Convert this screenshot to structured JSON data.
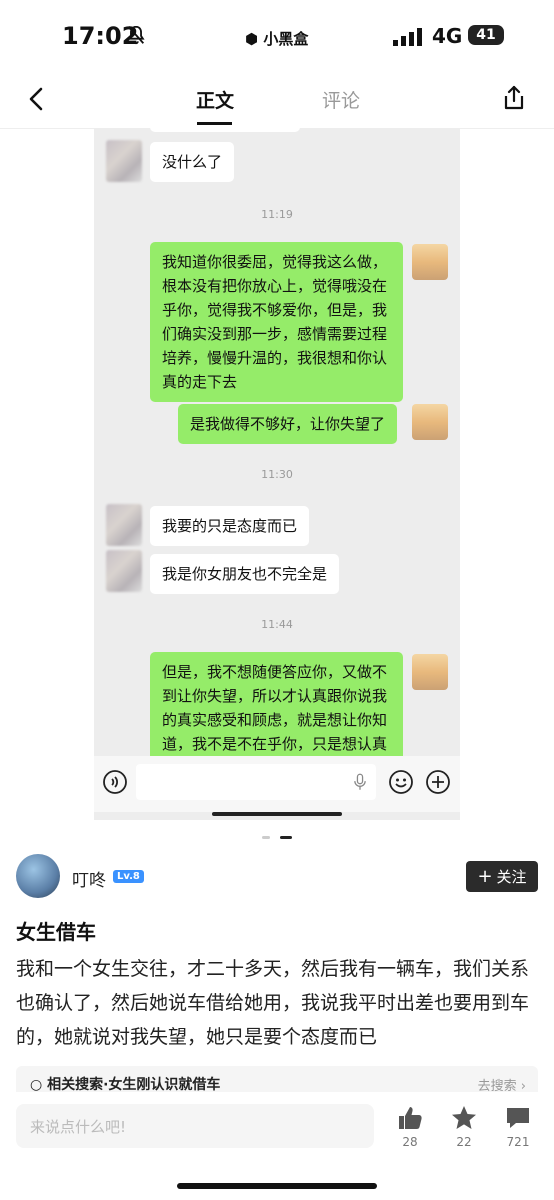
{
  "status_bar": {
    "time": "17:02",
    "app": "小黑盒",
    "network": "4G",
    "battery": "41"
  },
  "nav": {
    "tab_main": "正文",
    "tab_comment": "评论"
  },
  "chat": {
    "top_in": "没什么了",
    "time1": "11:19",
    "out1": "我知道你很委屈，觉得我这么做，根本没有把你放心上，觉得哦没在乎你，觉得我不够爱你，但是，我们确实没到那一步，感情需要过程培养，慢慢升温的，我很想和你认真的走下去",
    "out2": "是我做得不够好，让你失望了",
    "time2": "11:30",
    "in1": "我要的只是态度而已",
    "in2": "我是你女朋友也不完全是",
    "time3": "11:44",
    "out3": "但是，我不想随便答应你，又做不到让你失望，所以才认真跟你说我的真实感受和顾虑，就是想让你知道，我不是不在乎你，只是想认真"
  },
  "author": {
    "name": "叮咚",
    "level": "Lv.8",
    "follow_label": "关注"
  },
  "post": {
    "title": "女生借车",
    "body": "我和一个女生交往，才二十多天，然后我有一辆车，我们关系也确认了，然后她说车借给她用，我说我平时出差也要用到车的，她就说对我失望，她只是要个态度而已"
  },
  "related": {
    "label": "相关搜索·女生刚认识就借车",
    "go": "去搜索"
  },
  "bottom": {
    "placeholder": "来说点什么吧!",
    "likes": "28",
    "favorites": "22",
    "comments": "721"
  }
}
